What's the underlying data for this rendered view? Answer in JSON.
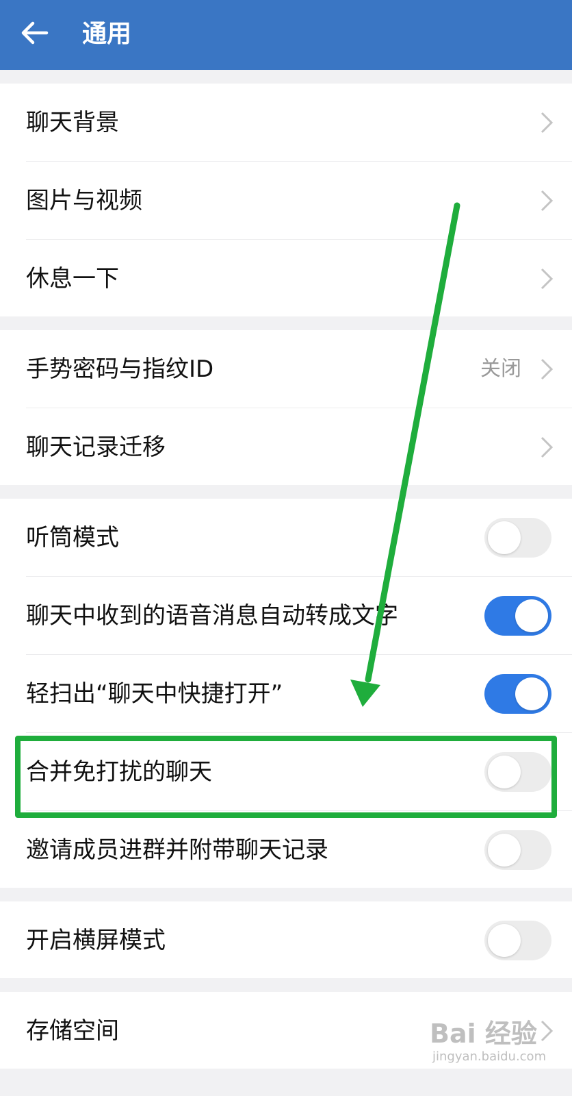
{
  "header": {
    "title": "通用"
  },
  "groups": {
    "g1": [
      {
        "label": "聊天背景"
      },
      {
        "label": "图片与视频"
      },
      {
        "label": "休息一下"
      }
    ],
    "g2": [
      {
        "label": "手势密码与指纹ID",
        "value": "关闭"
      },
      {
        "label": "聊天记录迁移"
      }
    ],
    "g3": [
      {
        "label": "听筒模式",
        "on": false
      },
      {
        "label": "聊天中收到的语音消息自动转成文字",
        "on": true
      },
      {
        "label": "轻扫出“聊天中快捷打开”",
        "on": true
      },
      {
        "label": "合并免打扰的聊天",
        "on": false
      },
      {
        "label": "邀请成员进群并附带聊天记录",
        "on": false
      }
    ],
    "g4": [
      {
        "label": "开启横屏模式",
        "on": false
      }
    ],
    "g5": [
      {
        "label": "存储空间"
      }
    ]
  },
  "annotation": {
    "color": "#1fad3c"
  },
  "colors": {
    "header": "#3a76c4",
    "toggle_on": "#2f7ae5",
    "toggle_off": "#ececec"
  },
  "watermark": {
    "logo": "Bai 经验",
    "url": "jingyan.baidu.com"
  }
}
